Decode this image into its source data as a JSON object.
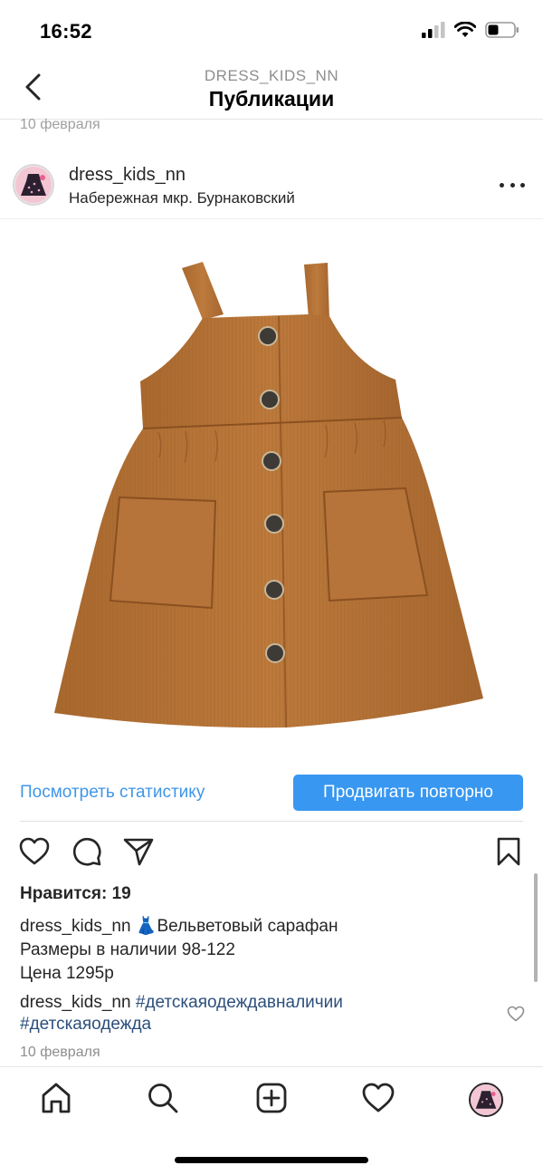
{
  "status_bar": {
    "time": "16:52",
    "icons": [
      "signal-icon",
      "wifi-icon",
      "battery-icon"
    ]
  },
  "header": {
    "subtitle": "DRESS_KIDS_NN",
    "title": "Публикации",
    "back_icon": "chevron-left-icon"
  },
  "previous_post": {
    "date": "10 февраля"
  },
  "post": {
    "username": "dress_kids_nn",
    "location": "Набережная мкр. Бурнаковский",
    "more_icon": "more-horizontal-icon",
    "photo_subject": "corduroy-pinafore-dress",
    "view_insights_label": "Посмотреть статистику",
    "promote_again_label": "Продвигать повторно",
    "likes_label": "Нравится: 19",
    "caption": {
      "username": "dress_kids_nn",
      "line1": "👗Вельветовый сарафан",
      "line2": "Размеры в наличии 98-122",
      "line3": "Цена 1295р"
    },
    "comment": {
      "username": "dress_kids_nn",
      "tag1": "#детскаяодеждавналичии",
      "tag2": "#детскаяодежда"
    },
    "date": "10 февраля"
  },
  "colors": {
    "accent_blue": "#3897f0",
    "link_blue": "#3f96e8",
    "hashtag": "#2c4f7c",
    "dress": "#b8763a",
    "secondary_text": "#8e8e8e"
  },
  "tab_bar": [
    "home-icon",
    "search-icon",
    "new-post-icon",
    "activity-heart-icon",
    "profile-avatar"
  ]
}
